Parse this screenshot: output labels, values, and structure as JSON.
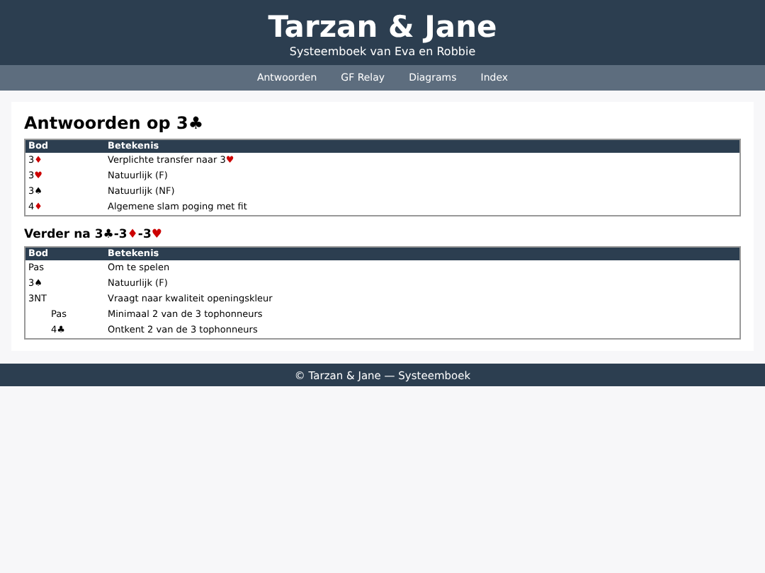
{
  "header": {
    "title": "Tarzan & Jane",
    "subtitle": "Systeemboek van Eva en Robbie"
  },
  "nav": [
    "Antwoorden",
    "GF Relay",
    "Diagrams",
    "Index"
  ],
  "sections": [
    {
      "title": [
        {
          "text": "Antwoorden op 3♣"
        }
      ],
      "columns": [
        "Bod",
        "Betekenis"
      ],
      "rows": [
        {
          "bid": [
            {
              "text": "3"
            },
            {
              "text": "♦",
              "color": "#cc0000"
            }
          ],
          "meaning": [
            {
              "text": "Verplichte transfer naar 3"
            },
            {
              "text": "♥",
              "color": "#cc0000"
            }
          ]
        },
        {
          "bid": [
            {
              "text": "3"
            },
            {
              "text": "♥",
              "color": "#cc0000"
            }
          ],
          "meaning": [
            {
              "text": "Natuurlijk (F)"
            }
          ]
        },
        {
          "bid": [
            {
              "text": "3♠"
            }
          ],
          "meaning": [
            {
              "text": "Natuurlijk (NF)"
            }
          ]
        },
        {
          "bid": [
            {
              "text": "4"
            },
            {
              "text": "♦",
              "color": "#cc0000"
            }
          ],
          "meaning": [
            {
              "text": "Algemene slam poging met fit"
            }
          ]
        }
      ]
    },
    {
      "title": [
        {
          "text": "Verder na 3♣-3"
        },
        {
          "text": "♦",
          "color": "#cc0000"
        },
        {
          "text": "-3"
        },
        {
          "text": "♥",
          "color": "#cc0000"
        }
      ],
      "columns": [
        "Bod",
        "Betekenis"
      ],
      "rows": [
        {
          "bid": [
            {
              "text": "Pas"
            }
          ],
          "meaning": [
            {
              "text": "Om te spelen"
            }
          ]
        },
        {
          "bid": [
            {
              "text": "3♠"
            }
          ],
          "meaning": [
            {
              "text": "Natuurlijk (F)"
            }
          ]
        },
        {
          "bid": [
            {
              "text": "3NT"
            }
          ],
          "meaning": [
            {
              "text": "Vraagt naar kwaliteit openingskleur"
            }
          ],
          "children": [
            {
              "bid": [
                {
                  "text": "Pas"
                }
              ],
              "meaning": [
                {
                  "text": "Minimaal 2 van de 3 tophonneurs"
                }
              ]
            },
            {
              "bid": [
                {
                  "text": "4♣"
                }
              ],
              "meaning": [
                {
                  "text": "Ontkent 2 van de 3 tophonneurs"
                }
              ]
            }
          ]
        }
      ]
    }
  ],
  "footer": "© Tarzan & Jane — Systeemboek"
}
